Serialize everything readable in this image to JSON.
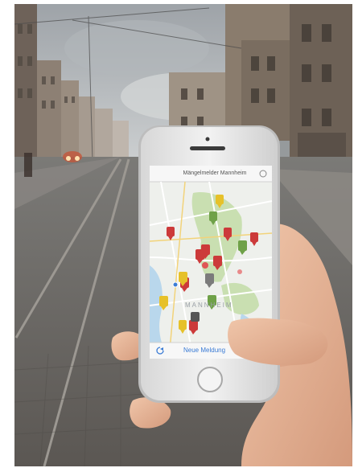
{
  "app": {
    "title": "Mängelmelder Mannheim",
    "map_label": "MANNHEIM",
    "toolbar": {
      "refresh_icon": "refresh-icon",
      "new_report_label": "Neue Meldung"
    }
  },
  "colors": {
    "sky": "#bfc3c6",
    "building": "#8c7f72",
    "street": "#6a6a68",
    "phone_body": "#e6e6e6",
    "map_bg": "#eef0ec",
    "park": "#c9dfb1",
    "water": "#b9d7ec",
    "marker_red": "#cc3a3a",
    "marker_yellow": "#e6c12a",
    "marker_green": "#6fa148",
    "accent_blue": "#3a7bd5",
    "skin": "#e9b99c"
  }
}
